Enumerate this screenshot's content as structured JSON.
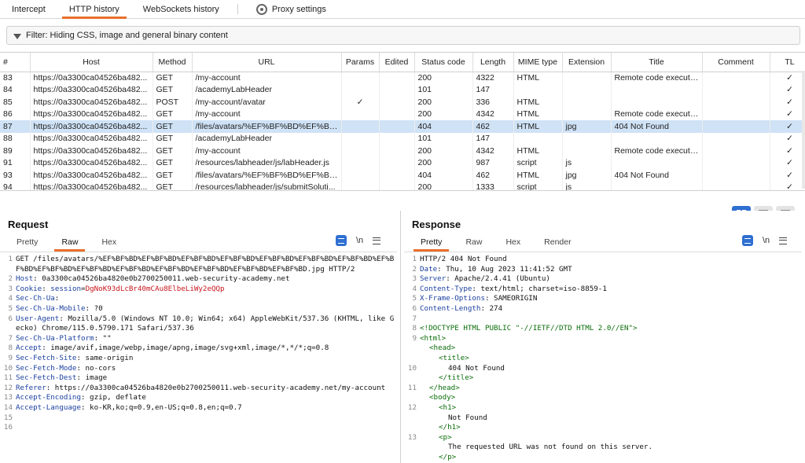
{
  "top_tabs": [
    "Intercept",
    "HTTP history",
    "WebSockets history",
    "Proxy settings"
  ],
  "filter": "Filter: Hiding CSS, image and general binary content",
  "table": {
    "columns": [
      "#",
      "Host",
      "Method",
      "URL",
      "Params",
      "Edited",
      "Status code",
      "Length",
      "MIME type",
      "Extension",
      "Title",
      "Comment",
      "TL"
    ],
    "rows": [
      [
        "83",
        "https://0a3300ca04526ba482...",
        "GET",
        "/my-account",
        "",
        "",
        "200",
        "4322",
        "HTML",
        "",
        "Remote code execution...",
        "",
        "✓"
      ],
      [
        "84",
        "https://0a3300ca04526ba482...",
        "GET",
        "/academyLabHeader",
        "",
        "",
        "101",
        "147",
        "",
        "",
        "",
        "",
        "✓"
      ],
      [
        "85",
        "https://0a3300ca04526ba482...",
        "POST",
        "/my-account/avatar",
        "✓",
        "",
        "200",
        "336",
        "HTML",
        "",
        "",
        "",
        "✓"
      ],
      [
        "86",
        "https://0a3300ca04526ba482...",
        "GET",
        "/my-account",
        "",
        "",
        "200",
        "4342",
        "HTML",
        "",
        "Remote code execution...",
        "",
        "✓"
      ],
      [
        "87",
        "https://0a3300ca04526ba482...",
        "GET",
        "/files/avatars/%EF%BF%BD%EF%BF%B...",
        "",
        "",
        "404",
        "462",
        "HTML",
        "jpg",
        "404 Not Found",
        "",
        "✓"
      ],
      [
        "88",
        "https://0a3300ca04526ba482...",
        "GET",
        "/academyLabHeader",
        "",
        "",
        "101",
        "147",
        "",
        "",
        "",
        "",
        "✓"
      ],
      [
        "89",
        "https://0a3300ca04526ba482...",
        "GET",
        "/my-account",
        "",
        "",
        "200",
        "4342",
        "HTML",
        "",
        "Remote code execution...",
        "",
        "✓"
      ],
      [
        "91",
        "https://0a3300ca04526ba482...",
        "GET",
        "/resources/labheader/js/labHeader.js",
        "",
        "",
        "200",
        "987",
        "script",
        "js",
        "",
        "",
        "✓"
      ],
      [
        "93",
        "https://0a3300ca04526ba482...",
        "GET",
        "/files/avatars/%EF%BF%BD%EF%BF%B...",
        "",
        "",
        "404",
        "462",
        "HTML",
        "jpg",
        "404 Not Found",
        "",
        "✓"
      ],
      [
        "94",
        "https://0a3300ca04526ba482...",
        "GET",
        "/resources/labheader/js/submitSoluti...",
        "",
        "",
        "200",
        "1333",
        "script",
        "js",
        "",
        "",
        "✓"
      ]
    ],
    "selected_row": "87"
  },
  "request": {
    "title": "Request",
    "tabs": [
      "Pretty",
      "Raw",
      "Hex"
    ],
    "active_tab": "Raw",
    "newline_label": "\\n",
    "lines": [
      {
        "n": "1",
        "parts": [
          [
            "",
            "GET /files/avatars/%EF%BF%BD%EF%BF%BD%EF%BF%BD%EF%BF%BD%EF%BF%BD%EF%BF%BD%EF%BF%BD%EF%BF%BD%EF%BF%BD%EF%BF%BD%EF%BF%BD%EF%BF%BD%EF%BF%BD%EF%BF%BD%EF%BF%BD.jpg HTTP/2"
          ]
        ]
      },
      {
        "n": "2",
        "parts": [
          [
            "hk",
            "Host"
          ],
          [
            "",
            ": 0a3300ca04526ba4820e0b2700250011.web-security-academy.net"
          ]
        ]
      },
      {
        "n": "3",
        "parts": [
          [
            "hk",
            "Cookie"
          ],
          [
            "",
            ": "
          ],
          [
            "hk",
            "session"
          ],
          [
            "",
            "="
          ],
          [
            "ck",
            "DgNoK93dLcBr40mCAu8ElbeLiWy2eQQp"
          ]
        ]
      },
      {
        "n": "4",
        "parts": [
          [
            "hk",
            "Sec-Ch-Ua"
          ],
          [
            "",
            ":"
          ]
        ]
      },
      {
        "n": "5",
        "parts": [
          [
            "hk",
            "Sec-Ch-Ua-Mobile"
          ],
          [
            "",
            ": ?0"
          ]
        ]
      },
      {
        "n": "6",
        "parts": [
          [
            "hk",
            "User-Agent"
          ],
          [
            "",
            ": Mozilla/5.0 (Windows NT 10.0; Win64; x64) AppleWebKit/537.36 (KHTML, like Gecko) Chrome/115.0.5790.171 Safari/537.36"
          ]
        ]
      },
      {
        "n": "7",
        "parts": [
          [
            "hk",
            "Sec-Ch-Ua-Platform"
          ],
          [
            "",
            ": \"\""
          ]
        ]
      },
      {
        "n": "8",
        "parts": [
          [
            "hk",
            "Accept"
          ],
          [
            "",
            ": image/avif,image/webp,image/apng,image/svg+xml,image/*,*/*;q=0.8"
          ]
        ]
      },
      {
        "n": "9",
        "parts": [
          [
            "hk",
            "Sec-Fetch-Site"
          ],
          [
            "",
            ": same-origin"
          ]
        ]
      },
      {
        "n": "10",
        "parts": [
          [
            "hk",
            "Sec-Fetch-Mode"
          ],
          [
            "",
            ": no-cors"
          ]
        ]
      },
      {
        "n": "11",
        "parts": [
          [
            "hk",
            "Sec-Fetch-Dest"
          ],
          [
            "",
            ": image"
          ]
        ]
      },
      {
        "n": "12",
        "parts": [
          [
            "hk",
            "Referer"
          ],
          [
            "",
            ": https://0a3300ca04526ba4820e0b2700250011.web-security-academy.net/my-account"
          ]
        ]
      },
      {
        "n": "13",
        "parts": [
          [
            "hk",
            "Accept-Encoding"
          ],
          [
            "",
            ": gzip, deflate"
          ]
        ]
      },
      {
        "n": "14",
        "parts": [
          [
            "hk",
            "Accept-Language"
          ],
          [
            "",
            ": ko-KR,ko;q=0.9,en-US;q=0.8,en;q=0.7"
          ]
        ]
      },
      {
        "n": "15",
        "parts": []
      },
      {
        "n": "16",
        "parts": []
      }
    ]
  },
  "response": {
    "title": "Response",
    "tabs": [
      "Pretty",
      "Raw",
      "Hex",
      "Render"
    ],
    "active_tab": "Pretty",
    "newline_label": "\\n",
    "lines": [
      {
        "n": "1",
        "indent": 0,
        "parts": [
          [
            "",
            "HTTP/2 404 Not Found"
          ]
        ]
      },
      {
        "n": "2",
        "indent": 0,
        "parts": [
          [
            "hk",
            "Date"
          ],
          [
            "",
            ": Thu, 10 Aug 2023 11:41:52 GMT"
          ]
        ]
      },
      {
        "n": "3",
        "indent": 0,
        "parts": [
          [
            "hk",
            "Server"
          ],
          [
            "",
            ": Apache/2.4.41 (Ubuntu)"
          ]
        ]
      },
      {
        "n": "4",
        "indent": 0,
        "parts": [
          [
            "hk",
            "Content-Type"
          ],
          [
            "",
            ": text/html; charset=iso-8859-1"
          ]
        ]
      },
      {
        "n": "5",
        "indent": 0,
        "parts": [
          [
            "hk",
            "X-Frame-Options"
          ],
          [
            "",
            ": SAMEORIGIN"
          ]
        ]
      },
      {
        "n": "6",
        "indent": 0,
        "parts": [
          [
            "hk",
            "Content-Length"
          ],
          [
            "",
            ": 274"
          ]
        ]
      },
      {
        "n": "7",
        "indent": 0,
        "parts": []
      },
      {
        "n": "8",
        "indent": 0,
        "parts": [
          [
            "tg",
            "<!DOCTYPE HTML PUBLIC \"-//IETF//DTD HTML 2.0//EN\">"
          ]
        ]
      },
      {
        "n": "9",
        "indent": 0,
        "parts": [
          [
            "tg",
            "<html>"
          ]
        ]
      },
      {
        "n": "",
        "indent": 1,
        "parts": [
          [
            "tg",
            "<head>"
          ]
        ]
      },
      {
        "n": "",
        "indent": 2,
        "parts": [
          [
            "tg",
            "<title>"
          ]
        ]
      },
      {
        "n": "10",
        "indent": 3,
        "parts": [
          [
            "",
            "404 Not Found"
          ]
        ]
      },
      {
        "n": "",
        "indent": 2,
        "parts": [
          [
            "tg",
            "</title>"
          ]
        ]
      },
      {
        "n": "11",
        "indent": 1,
        "parts": [
          [
            "tg",
            "</head>"
          ]
        ]
      },
      {
        "n": "",
        "indent": 1,
        "parts": [
          [
            "tg",
            "<body>"
          ]
        ]
      },
      {
        "n": "12",
        "indent": 2,
        "parts": [
          [
            "tg",
            "<h1>"
          ]
        ]
      },
      {
        "n": "",
        "indent": 3,
        "parts": [
          [
            "",
            "Not Found"
          ]
        ]
      },
      {
        "n": "",
        "indent": 2,
        "parts": [
          [
            "tg",
            "</h1>"
          ]
        ]
      },
      {
        "n": "13",
        "indent": 2,
        "parts": [
          [
            "tg",
            "<p>"
          ]
        ]
      },
      {
        "n": "",
        "indent": 3,
        "parts": [
          [
            "",
            "The requested URL was not found on this server."
          ]
        ]
      },
      {
        "n": "",
        "indent": 2,
        "parts": [
          [
            "tg",
            "</p>"
          ]
        ]
      }
    ]
  },
  "colors": {
    "accent": "#e8702a",
    "selection": "#cfe2f6",
    "header_key": "#1a3f9e",
    "cookie_value": "#c8161d",
    "html_tag": "#0b6d0b",
    "toggle_on": "#2f6fd1"
  }
}
